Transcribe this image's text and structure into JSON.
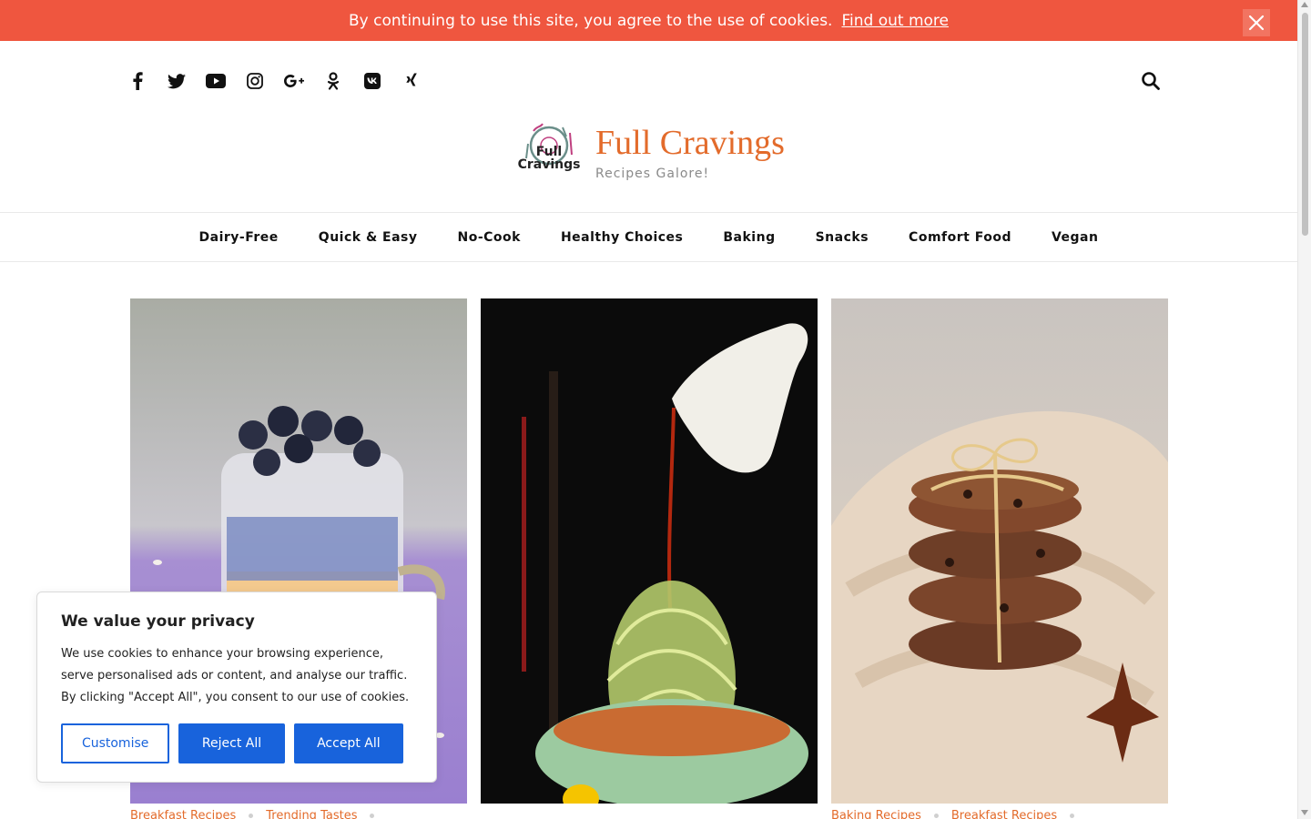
{
  "cookie_bar": {
    "message": "By continuing to use this site, you agree to the use of cookies.",
    "link": "Find out more",
    "close_icon": "close-icon",
    "color": "#ef563f"
  },
  "header": {
    "social_icons": [
      "facebook-icon",
      "twitter-icon",
      "youtube-icon",
      "instagram-icon",
      "google-plus-icon",
      "odnoklassniki-icon",
      "vk-icon",
      "xing-icon"
    ],
    "search_icon": "search-icon",
    "logo_text": "Full Cravings",
    "site_title": "Full Cravings",
    "tagline": "Recipes Galore!",
    "accent_color": "#e36b2b"
  },
  "nav": {
    "items": [
      "Dairy-Free",
      "Quick & Easy",
      "No-Cook",
      "Healthy Choices",
      "Baking",
      "Snacks",
      "Comfort Food",
      "Vegan"
    ]
  },
  "cards": [
    {
      "image": "blueberry-chia-pudding-photo",
      "categories": [
        "Breakfast Recipes",
        "Trending Tastes"
      ]
    },
    {
      "image": "zoodles-sauce-pour-photo",
      "categories": []
    },
    {
      "image": "chocolate-chip-cookies-photo",
      "categories": [
        "Baking Recipes",
        "Breakfast Recipes"
      ]
    }
  ],
  "privacy": {
    "title": "We value your privacy",
    "body": "We use cookies to enhance your browsing experience, serve personalised ads or content, and analyse our traffic. By clicking \"Accept All\", you consent to our use of cookies.",
    "customise": "Customise",
    "reject": "Reject All",
    "accept": "Accept All",
    "button_color": "#1863dc"
  }
}
